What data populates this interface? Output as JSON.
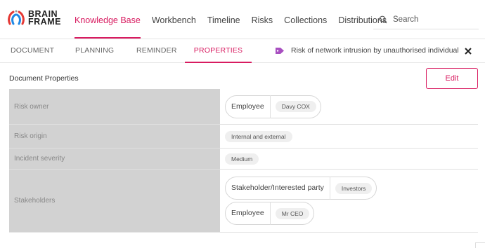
{
  "app": {
    "logo_line1": "BRAIN",
    "logo_line2": "FRAME"
  },
  "nav": {
    "items": [
      {
        "label": "Knowledge Base",
        "active": true
      },
      {
        "label": "Workbench"
      },
      {
        "label": "Timeline"
      },
      {
        "label": "Risks"
      },
      {
        "label": "Collections"
      },
      {
        "label": "Distributions"
      }
    ],
    "search_placeholder": "Search"
  },
  "tabs": [
    {
      "label": "DOCUMENT"
    },
    {
      "label": "PLANNING"
    },
    {
      "label": "REMINDER"
    },
    {
      "label": "PROPERTIES",
      "active": true
    }
  ],
  "risk": {
    "title": "Risk of network intrusion by unauthorised individual",
    "tag_icon": "tag-icon",
    "close_icon": "close-icon"
  },
  "section": {
    "title": "Document Properties",
    "edit_label": "Edit"
  },
  "properties": [
    {
      "label": "Risk owner",
      "groups": [
        {
          "role": "Employee",
          "value": "Davy COX"
        }
      ]
    },
    {
      "label": "Risk origin",
      "value": "Internal and external"
    },
    {
      "label": "Incident severity",
      "value": "Medium"
    },
    {
      "label": "Stakeholders",
      "groups": [
        {
          "role": "Stakeholder/Interested party",
          "value": "Investors"
        },
        {
          "role": "Employee",
          "value": "Mr CEO"
        }
      ]
    }
  ],
  "colors": {
    "accent": "#d81b60",
    "label_bg": "#d2d2d2",
    "tag": "#a84fc0"
  }
}
